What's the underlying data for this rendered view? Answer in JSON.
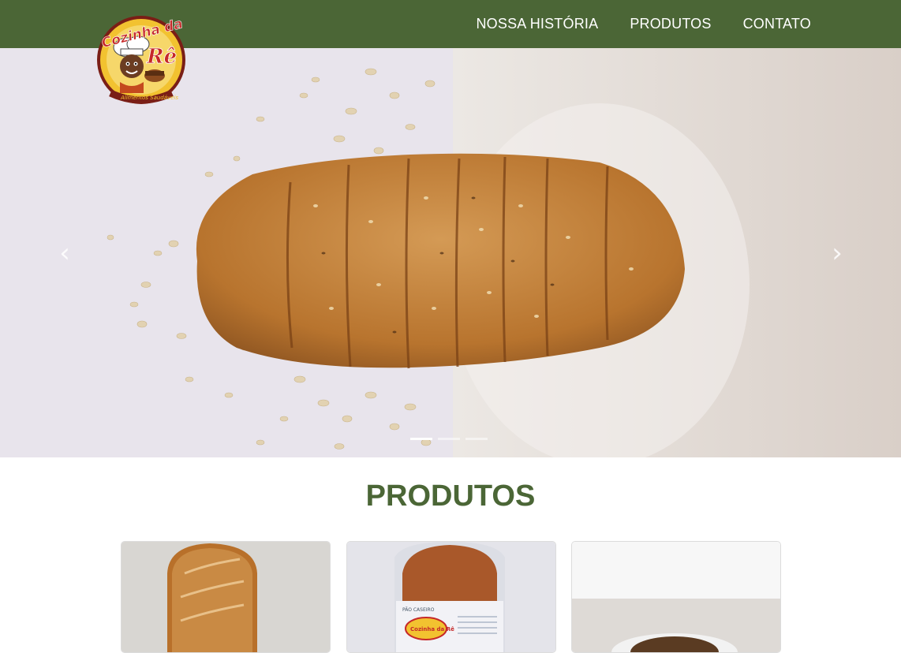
{
  "nav": {
    "links": [
      {
        "label": "NOSSA HISTÓRIA"
      },
      {
        "label": "PRODUTOS"
      },
      {
        "label": "CONTATO"
      }
    ]
  },
  "logo": {
    "brand_line1": "Cozinha da",
    "brand_line2": "Rê",
    "tagline": "Alimentos Saudáveis"
  },
  "carousel": {
    "prev_icon": "chevron-left-icon",
    "next_icon": "chevron-right-icon",
    "prev_glyph": "‹",
    "next_glyph": "›",
    "active_slide": 1,
    "slide_count": 3
  },
  "products": {
    "title": "PRODUTOS",
    "label_card2": "PÃO CASEIRO",
    "label_card2_logo": "Cozinha da Rê"
  },
  "colors": {
    "brand_green": "#4b6636",
    "logo_red": "#c62828",
    "logo_yellow": "#f2c230",
    "white": "#ffffff"
  }
}
